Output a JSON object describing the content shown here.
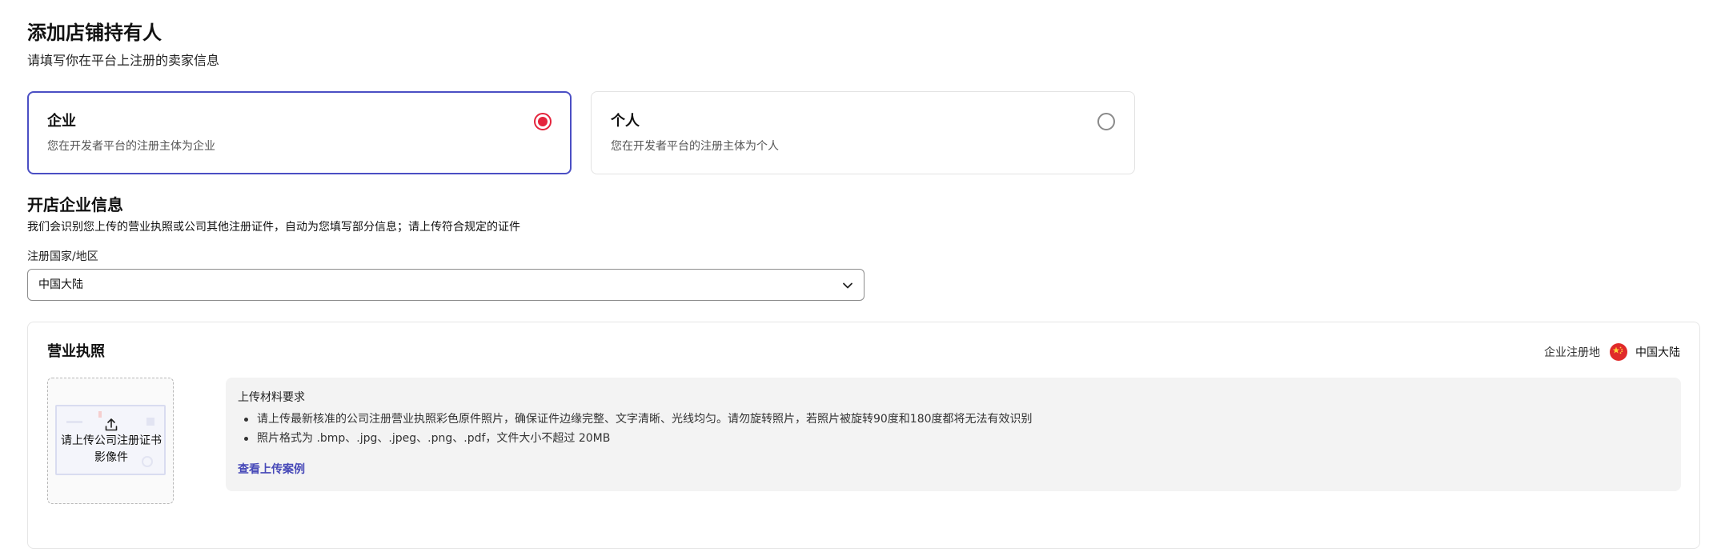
{
  "header": {
    "title": "添加店铺持有人",
    "subtitle": "请填写你在平台上注册的卖家信息"
  },
  "entity_types": [
    {
      "title": "企业",
      "description": "您在开发者平台的注册主体为企业",
      "selected": true
    },
    {
      "title": "个人",
      "description": "您在开发者平台的注册主体为个人",
      "selected": false
    }
  ],
  "company_section": {
    "title": "开店企业信息",
    "description": "我们会识别您上传的营业执照或公司其他注册证件，自动为您填写部分信息；请上传符合规定的证件"
  },
  "country_field": {
    "label": "注册国家/地区",
    "value": "中国大陆"
  },
  "license": {
    "title": "营业执照",
    "region_label": "企业注册地",
    "region_value": "中国大陆",
    "upload_text": "请上传公司注册证书影像件",
    "requirements_title": "上传材料要求",
    "requirements": [
      "请上传最新核准的公司注册营业执照彩色原件照片，确保证件边缘完整、文字清晰、光线均匀。请勿旋转照片，若照片被旋转90度和180度都将无法有效识别",
      "照片格式为 .bmp、.jpg、.jpeg、.png、.pdf，文件大小不超过 20MB"
    ],
    "example_link": "查看上传案例"
  },
  "colors": {
    "accent": "#4b4fc4",
    "radio_selected": "#e4243c",
    "link": "#4648b8",
    "flag": "#e02a2a"
  },
  "icons": {
    "radio_selected": "radio-selected-icon",
    "radio_unselected": "radio-unselected-icon",
    "dropdown": "chevron-down-icon",
    "flag": "china-flag-icon",
    "upload": "upload-icon"
  }
}
